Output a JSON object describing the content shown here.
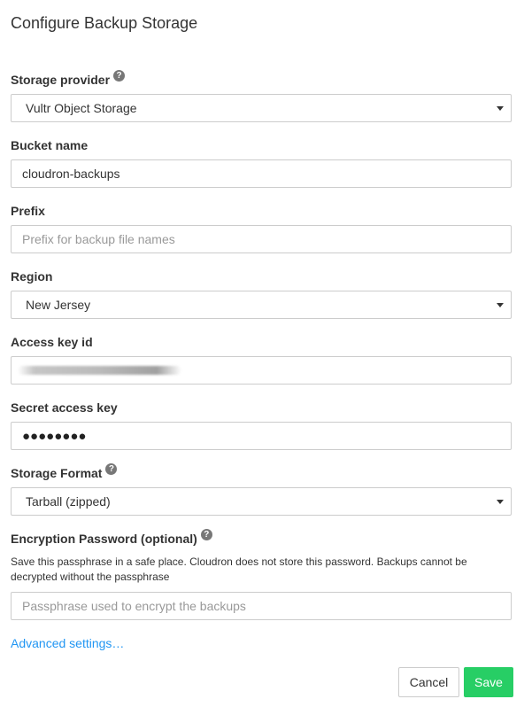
{
  "dialog": {
    "title": "Configure Backup Storage"
  },
  "form": {
    "storage_provider": {
      "label": "Storage provider",
      "help_glyph": "?",
      "value": "Vultr Object Storage"
    },
    "bucket_name": {
      "label": "Bucket name",
      "value": "cloudron-backups"
    },
    "prefix": {
      "label": "Prefix",
      "placeholder": "Prefix for backup file names",
      "value": ""
    },
    "region": {
      "label": "Region",
      "value": "New Jersey"
    },
    "access_key_id": {
      "label": "Access key id"
    },
    "secret_access_key": {
      "label": "Secret access key",
      "value": "●●●●●●●●"
    },
    "storage_format": {
      "label": "Storage Format",
      "help_glyph": "?",
      "value": "Tarball (zipped)"
    },
    "encryption_password": {
      "label": "Encryption Password (optional)",
      "help_glyph": "?",
      "note": "Save this passphrase in a safe place. Cloudron does not store this password. Backups cannot be decrypted without the passphrase",
      "placeholder": "Passphrase used to encrypt the backups",
      "value": ""
    },
    "advanced_link": "Advanced settings…"
  },
  "actions": {
    "cancel_label": "Cancel",
    "save_label": "Save"
  },
  "colors": {
    "accent_link": "#2196f3",
    "save_button": "#27ce65",
    "border": "#cccccc"
  },
  "icons": {
    "help": "question-circle-icon",
    "dropdown": "caret-down-icon"
  }
}
